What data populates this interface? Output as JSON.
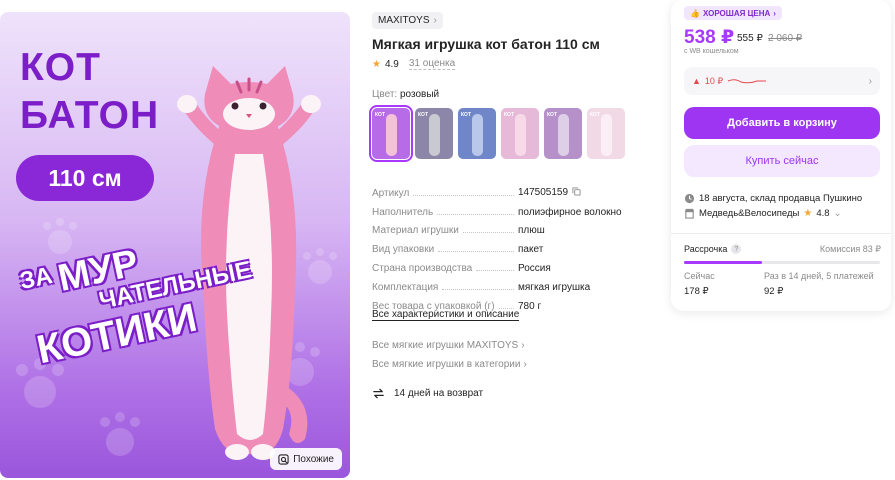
{
  "image": {
    "title_line1": "КОТ",
    "title_line2": "БАТОН",
    "size_badge": "110 см",
    "slogan": [
      "ЗА",
      "МУР",
      "ЧАТЕЛЬНЫЕ",
      "КОТИКИ"
    ],
    "similar_button": "Похожие",
    "similar_icon": "search-similar-icon"
  },
  "product": {
    "brand": "MAXITOYS",
    "title": "Мягкая игрушка кот батон 110 см",
    "rating": "4.9",
    "reviews": "31 оценка",
    "color_label": "Цвет:",
    "color_value": "розовый",
    "swatches": [
      {
        "name": "pink",
        "bg": "#b86be6",
        "cat": "#f3c2d8",
        "active": true
      },
      {
        "name": "grey",
        "bg": "#8c87a8",
        "cat": "#c9c9d2",
        "active": false
      },
      {
        "name": "blue",
        "bg": "#6f86c8",
        "cat": "#b9c7ea",
        "active": false
      },
      {
        "name": "light-pink",
        "bg": "#e6b9d8",
        "cat": "#f7d9e8",
        "active": false
      },
      {
        "name": "purple",
        "bg": "#b590c9",
        "cat": "#ddd0e6",
        "active": false
      },
      {
        "name": "pale",
        "bg": "#f1d9e6",
        "cat": "#fbeef4",
        "active": false
      }
    ],
    "specs": [
      {
        "name": "Артикул",
        "value": "147505159",
        "copy": true
      },
      {
        "name": "Наполнитель",
        "value": "полиэфирное волокно"
      },
      {
        "name": "Материал игрушки",
        "value": "плюш"
      },
      {
        "name": "Вид упаковки",
        "value": "пакет"
      },
      {
        "name": "Страна производства",
        "value": "Россия"
      },
      {
        "name": "Комплектация",
        "value": "мягкая игрушка"
      },
      {
        "name": "Вес товара с упаковкой (г)",
        "value": "780 г"
      }
    ],
    "all_specs_link": "Все характеристики и описание",
    "brand_link": "Все мягкие игрушки MAXITOYS",
    "category_link": "Все мягкие игрушки в категории",
    "return_policy": "14 дней на возврат"
  },
  "price_card": {
    "badge": "ХОРОШАЯ ЦЕНА",
    "price": "538 ₽",
    "price_without_wallet": "555 ₽",
    "old_price": "2 060 ₽",
    "wallet_note": "с WB кошельком",
    "price_change": "10 ₽",
    "add_to_cart": "Добавить в корзину",
    "buy_now": "Купить сейчас",
    "delivery": "18 августа, склад продавца Пушкино",
    "seller": "Медведь&Велосипеды",
    "seller_rating": "4.8",
    "installment_label": "Рассрочка",
    "commission": "Комиссия 83 ₽",
    "installment_progress": 0.4,
    "now_label": "Сейчас",
    "now_value": "178 ₽",
    "plan_label": "Раз в 14 дней, 5 платежей",
    "plan_value": "92 ₽"
  },
  "colors": {
    "accent": "#a73afd",
    "accent_dark": "#7b1ec8",
    "price_down": "#e5484d"
  }
}
